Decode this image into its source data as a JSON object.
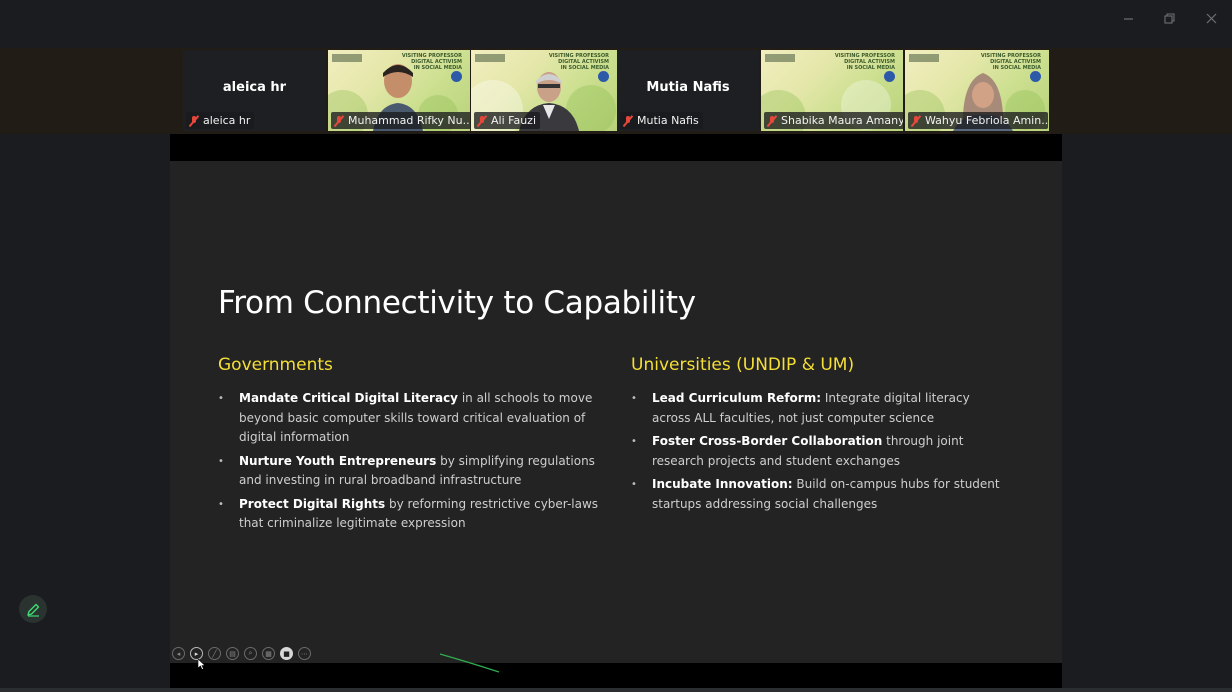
{
  "window": {
    "minimize_icon": "minimize-icon",
    "restore_icon": "restore-icon",
    "close_icon": "close-icon"
  },
  "participants": [
    {
      "name": "aleica hr",
      "video": false,
      "muted": true
    },
    {
      "name": "Muhammad Rifky Nu...",
      "video": true,
      "muted": true
    },
    {
      "name": "Ali Fauzi",
      "video": true,
      "muted": true,
      "active_speaker": true
    },
    {
      "name": "Mutia Nafis",
      "video": false,
      "muted": true
    },
    {
      "name": "Shabika Maura Amany",
      "video": true,
      "muted": true
    },
    {
      "name": "Wahyu Febriola Amin...",
      "video": true,
      "muted": true
    }
  ],
  "video_banner": {
    "line1": "VISITING PROFESSOR",
    "line2": "DIGITAL ACTIVISM",
    "line3": "IN SOCIAL MEDIA"
  },
  "slide": {
    "title": "From Connectivity to Capability",
    "left": {
      "heading": "Governments",
      "items": [
        {
          "bold": "Mandate Critical Digital Literacy",
          "rest": " in all schools to move beyond basic computer skills toward critical evaluation of digital information"
        },
        {
          "bold": "Nurture Youth Entrepreneurs",
          "rest": " by simplifying regulations and investing in rural broadband infrastructure"
        },
        {
          "bold": "Protect Digital Rights",
          "rest": " by reforming restrictive cyber-laws that criminalize legitimate expression"
        }
      ]
    },
    "right": {
      "heading": "Universities (UNDIP & UM)",
      "items": [
        {
          "bold": "Lead Curriculum Reform:",
          "rest": " Integrate digital literacy across ALL faculties, not just computer science"
        },
        {
          "bold": "Foster Cross-Border Collaboration",
          "rest": " through joint research projects and student exchanges"
        },
        {
          "bold": "Incubate Innovation:",
          "rest": " Build on-campus hubs for student startups addressing social challenges"
        }
      ]
    }
  },
  "toolbar": {
    "buttons": [
      "prev-slide-icon",
      "next-slide-icon",
      "pen-icon",
      "highlighter-icon",
      "zoom-icon",
      "slides-grid-icon",
      "camera-icon",
      "more-icon"
    ]
  },
  "colors": {
    "accent_heading": "#f5df37",
    "active_speaker": "#2fd466",
    "mute": "#e5483b"
  }
}
